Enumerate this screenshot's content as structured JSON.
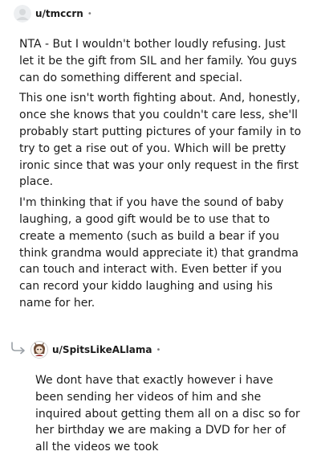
{
  "comments": [
    {
      "username": "u/tmccrn",
      "separator": "•",
      "paragraphs": [
        "NTA - But I wouldn't bother loudly refusing. Just let it be the gift from SIL and her family. You guys can do something different and special.",
        "This one isn't worth fighting about. And, honestly, once she knows that you couldn't care less, she'll probably start putting pictures of your family in to try to get a rise out of you. Which will be pretty ironic since that was your only request in the first place.",
        "I'm thinking that if you have the sound of baby laughing, a good gift would be to use that to create a memento (such as build a bear if you think grandma would appreciate it) that grandma can touch and interact with. Even better if you can record your kiddo laughing and using his name for her."
      ]
    },
    {
      "username": "u/SpitsLikeALlama",
      "separator": "•",
      "paragraphs": [
        "We dont have that exactly however i have been sending her videos of him and she inquired about getting them all on a disc so for her birthday we are making a DVD for her of all the videos we took"
      ]
    }
  ],
  "icons": {
    "avatar_1": "default-avatar-icon",
    "avatar_2": "llama-avatar-icon",
    "reply": "reply-arrow-icon"
  }
}
